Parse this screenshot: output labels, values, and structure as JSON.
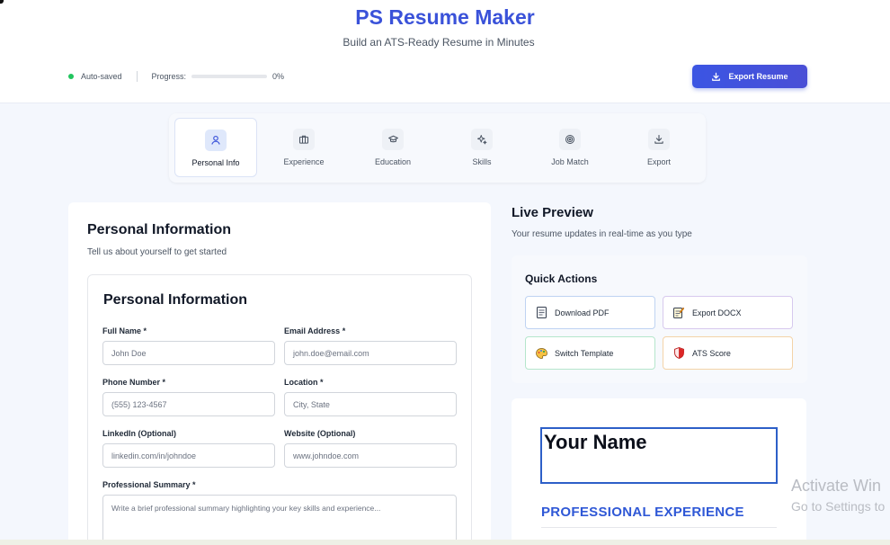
{
  "header": {
    "title": "PS Resume Maker",
    "subtitle": "Build an ATS-Ready Resume in Minutes",
    "status": "Auto-saved",
    "progress_label": "Progress:",
    "progress_value": "0%",
    "progress_fraction": 0,
    "export_label": "Export Resume"
  },
  "tabs": [
    {
      "label": "Personal Info",
      "icon": "user-icon",
      "active": true
    },
    {
      "label": "Experience",
      "icon": "briefcase-icon",
      "active": false
    },
    {
      "label": "Education",
      "icon": "graduation-cap-icon",
      "active": false
    },
    {
      "label": "Skills",
      "icon": "sparkles-icon",
      "active": false
    },
    {
      "label": "Job Match",
      "icon": "target-icon",
      "active": false
    },
    {
      "label": "Export",
      "icon": "download-icon",
      "active": false
    }
  ],
  "form": {
    "title": "Personal Information",
    "subtitle": "Tell us about yourself to get started",
    "card_title": "Personal Information",
    "fields": {
      "full_name": {
        "label": "Full Name *",
        "placeholder": "John Doe"
      },
      "email": {
        "label": "Email Address *",
        "placeholder": "john.doe@email.com"
      },
      "phone": {
        "label": "Phone Number *",
        "placeholder": "(555) 123-4567"
      },
      "location": {
        "label": "Location *",
        "placeholder": "City, State"
      },
      "linkedin": {
        "label": "LinkedIn (Optional)",
        "placeholder": "linkedin.com/in/johndoe"
      },
      "website": {
        "label": "Website (Optional)",
        "placeholder": "www.johndoe.com"
      },
      "summary": {
        "label": "Professional Summary *",
        "placeholder": "Write a brief professional summary highlighting your key skills and experience..."
      }
    }
  },
  "preview": {
    "title": "Live Preview",
    "subtitle": "Your resume updates in real-time as you type",
    "quick_actions_title": "Quick Actions",
    "actions": {
      "download_pdf": "Download PDF",
      "export_docx": "Export DOCX",
      "switch_template": "Switch Template",
      "ats_score": "ATS Score"
    },
    "resume_name": "Your Name",
    "section_heading": "PROFESSIONAL EXPERIENCE"
  },
  "watermark": {
    "line1": "Activate Win",
    "line2": "Go to Settings to"
  },
  "colors": {
    "accent": "#3a52d9",
    "status_ok": "#22c55e",
    "preview_heading": "#2f58d6"
  }
}
